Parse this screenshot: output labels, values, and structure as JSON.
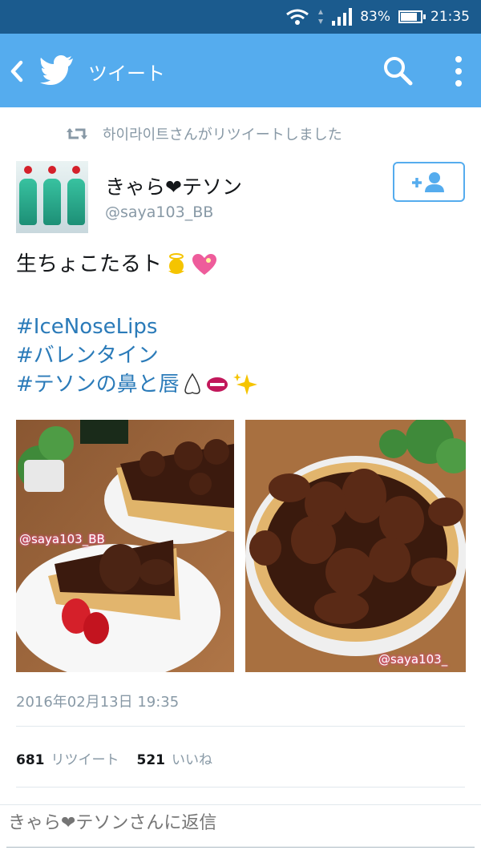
{
  "status_bar": {
    "battery": "83%",
    "time": "21:35",
    "battery_level": 0.83
  },
  "app_bar": {
    "title": "ツイート",
    "back_icon": "chevron-left-icon",
    "logo_icon": "twitter-bird-icon",
    "search_icon": "search-icon",
    "more_icon": "more-vertical-icon"
  },
  "retweet": {
    "text": "하이라이트さんがリツイートしました",
    "icon": "retweet-icon"
  },
  "author": {
    "display_name": "きゃら❤テソン",
    "handle": "@saya103_BB"
  },
  "follow_button": {
    "icon": "add-user-icon"
  },
  "tweet": {
    "text": "生ちょこたるト",
    "hashtags": [
      "#IceNoseLips",
      "#バレンタイン",
      "#テソンの鼻と唇"
    ]
  },
  "photos": [
    {
      "watermark": "@saya103_BB"
    },
    {
      "watermark": "@saya103_"
    }
  ],
  "timestamp": "2016年02月13日 19:35",
  "stats": {
    "retweets": "681",
    "retweets_label": "リツイート",
    "likes": "521",
    "likes_label": "いいね"
  },
  "reply": {
    "placeholder": "きゃら❤テソンさんに返信"
  },
  "colors": {
    "status_bar": "#1b5b8e",
    "app_bar": "#55acee",
    "hashtag": "#2b7bb9",
    "muted": "#8899a6"
  }
}
